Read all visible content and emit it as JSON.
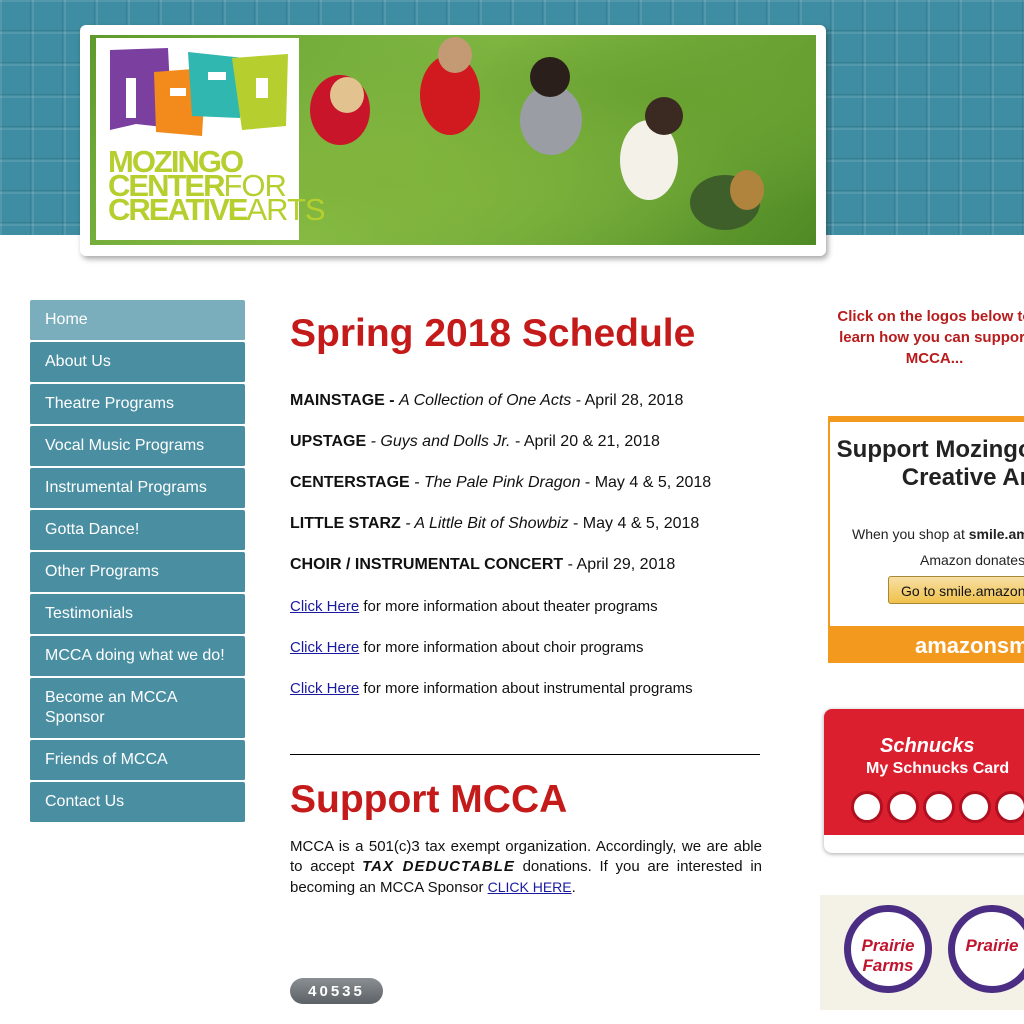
{
  "header": {
    "logo": {
      "line1": "MOZINGO",
      "line2_bold": "CENTER",
      "line2_thin": "FOR",
      "line3_bold": "CREATIVE",
      "line3_thin": "ARTS",
      "colors": [
        "#7b3fa0",
        "#f28a1c",
        "#2fb7b0",
        "#b6cf2e"
      ]
    }
  },
  "nav": {
    "items": [
      {
        "label": "Home",
        "active": true
      },
      {
        "label": "About Us"
      },
      {
        "label": "Theatre Programs"
      },
      {
        "label": "Vocal Music Programs"
      },
      {
        "label": "Instrumental Programs"
      },
      {
        "label": "Gotta Dance!"
      },
      {
        "label": "Other Programs"
      },
      {
        "label": "Testimonials"
      },
      {
        "label": "MCCA doing what we do!"
      },
      {
        "label": "Become an MCCA Sponsor"
      },
      {
        "label": "Friends of MCCA"
      },
      {
        "label": "Contact Us"
      }
    ]
  },
  "main": {
    "schedule_title": "Spring 2018 Schedule",
    "schedule": [
      {
        "label": "MAINSTAGE -",
        "show": "A Collection of One Acts",
        "date": " - April 28, 2018"
      },
      {
        "label": "UPSTAGE",
        "show": " - Guys and Dolls Jr.",
        "date": " - April 20 & 21, 2018"
      },
      {
        "label": "CENTERSTAGE",
        "show": " - The Pale Pink Dragon",
        "date": " - May 4 & 5, 2018"
      },
      {
        "label": "LITTLE STARZ",
        "show": " - A Little Bit of Showbiz",
        "date": " - May 4 & 5, 2018"
      },
      {
        "label": "CHOIR / INSTRUMENTAL CONCERT",
        "show": "",
        "date": " - April 29, 2018"
      }
    ],
    "info_links": [
      {
        "link": "Click Here",
        "text": " for more information about theater programs"
      },
      {
        "link": "Click Here",
        "text": " for more information about choir programs"
      },
      {
        "link": "Click Here",
        "text": " for more information about instrumental programs"
      }
    ],
    "support_title": "Support MCCA",
    "support_text_1": "MCCA is a 501(c)3 tax exempt organization.  Accordingly, we are able to accept ",
    "support_tax": "TAX DEDUCTABLE",
    "support_text_2": " donations.  If you are interested in becoming an MCCA Sponsor ",
    "support_link": "CLICK HERE",
    "support_end": ".",
    "counter": "40535"
  },
  "right": {
    "note": "Click on the logos below to learn how you can support MCCA...",
    "amazon": {
      "title": "Support Mozingo Center Creative Arts",
      "sub_prefix": "When you shop at ",
      "sub_bold": "smile.amazon.com,",
      "sub2": "Amazon donates.",
      "button": "Go to smile.amazon.com",
      "footer": "amazonsmile"
    },
    "schnucks": {
      "brand": "Schnucks",
      "card": "My Schnucks Card"
    },
    "prairie": {
      "cap1": "Prairie Farms",
      "cap2": "Prairie"
    }
  }
}
